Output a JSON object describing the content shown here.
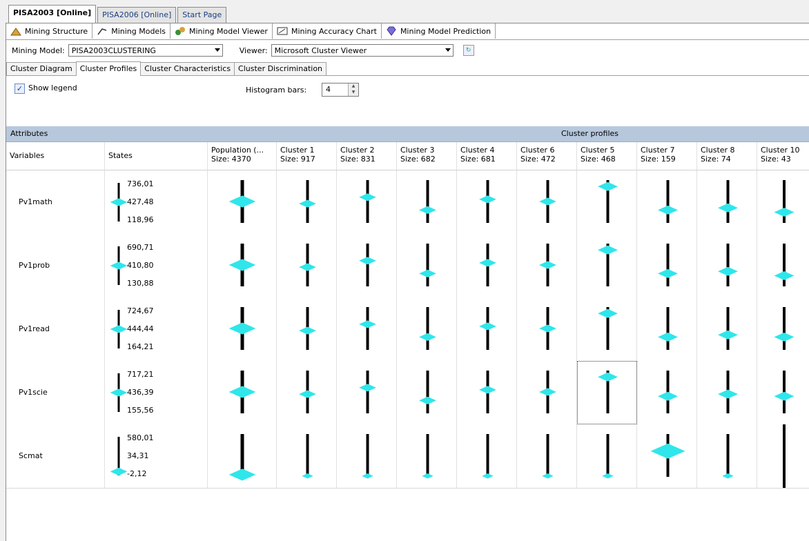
{
  "doc_tabs": [
    "PISA2003 [Online]",
    "PISA2006 [Online]",
    "Start Page"
  ],
  "designer_tabs": [
    {
      "label": "Mining Structure",
      "icon": "mining-structure-icon"
    },
    {
      "label": "Mining Models",
      "icon": "mining-models-icon"
    },
    {
      "label": "Mining Model Viewer",
      "icon": "mining-viewer-icon"
    },
    {
      "label": "Mining Accuracy Chart",
      "icon": "accuracy-chart-icon"
    },
    {
      "label": "Mining Model Prediction",
      "icon": "prediction-gem-icon"
    }
  ],
  "toolbar": {
    "model_label": "Mining Model:",
    "model_value": "PISA2003CLUSTERING",
    "viewer_label": "Viewer:",
    "viewer_value": "Microsoft Cluster Viewer"
  },
  "view_tabs": [
    "Cluster Diagram",
    "Cluster Profiles",
    "Cluster Characteristics",
    "Cluster Discrimination"
  ],
  "options": {
    "show_legend_label": "Show legend",
    "show_legend_checked": true,
    "histogram_label": "Histogram bars:",
    "histogram_value": "4"
  },
  "grid": {
    "band_attributes": "Attributes",
    "band_profiles": "Cluster profiles",
    "col_variables": "Variables",
    "col_states": "States",
    "columns": [
      {
        "name": "Population (...",
        "size": "Size: 4370"
      },
      {
        "name": "Cluster 1",
        "size": "Size: 917"
      },
      {
        "name": "Cluster 2",
        "size": "Size: 831"
      },
      {
        "name": "Cluster 3",
        "size": "Size: 682"
      },
      {
        "name": "Cluster 4",
        "size": "Size: 681"
      },
      {
        "name": "Cluster 6",
        "size": "Size: 472"
      },
      {
        "name": "Cluster 5",
        "size": "Size: 468"
      },
      {
        "name": "Cluster 7",
        "size": "Size: 159"
      },
      {
        "name": "Cluster 8",
        "size": "Size: 74"
      },
      {
        "name": "Cluster 10",
        "size": "Size: 43"
      }
    ],
    "rows": [
      {
        "variable": "Pv1math",
        "states": [
          "736,01",
          "427,48",
          "118,96"
        ],
        "profiles": [
          [
            0.5,
            0.22
          ],
          [
            0.45,
            0.12
          ],
          [
            0.6,
            0.12
          ],
          [
            0.3,
            0.12
          ],
          [
            0.55,
            0.12
          ],
          [
            0.5,
            0.12
          ],
          [
            0.85,
            0.15
          ],
          [
            0.3,
            0.15
          ],
          [
            0.35,
            0.15
          ],
          [
            0.25,
            0.15
          ]
        ]
      },
      {
        "variable": "Pv1prob",
        "states": [
          "690,71",
          "410,80",
          "130,88"
        ],
        "profiles": [
          [
            0.5,
            0.22
          ],
          [
            0.45,
            0.12
          ],
          [
            0.6,
            0.12
          ],
          [
            0.3,
            0.12
          ],
          [
            0.55,
            0.12
          ],
          [
            0.5,
            0.12
          ],
          [
            0.85,
            0.15
          ],
          [
            0.3,
            0.15
          ],
          [
            0.35,
            0.15
          ],
          [
            0.25,
            0.15
          ]
        ]
      },
      {
        "variable": "Pv1read",
        "states": [
          "724,67",
          "444,44",
          "164,21"
        ],
        "profiles": [
          [
            0.5,
            0.22
          ],
          [
            0.45,
            0.12
          ],
          [
            0.6,
            0.12
          ],
          [
            0.3,
            0.12
          ],
          [
            0.55,
            0.12
          ],
          [
            0.5,
            0.12
          ],
          [
            0.85,
            0.15
          ],
          [
            0.3,
            0.15
          ],
          [
            0.35,
            0.15
          ],
          [
            0.3,
            0.15
          ]
        ]
      },
      {
        "variable": "Pv1scie",
        "states": [
          "717,21",
          "436,39",
          "155,56"
        ],
        "profiles": [
          [
            0.5,
            0.22
          ],
          [
            0.45,
            0.12
          ],
          [
            0.6,
            0.12
          ],
          [
            0.3,
            0.12
          ],
          [
            0.55,
            0.12
          ],
          [
            0.5,
            0.12
          ],
          [
            0.85,
            0.15
          ],
          [
            0.4,
            0.15
          ],
          [
            0.45,
            0.15
          ],
          [
            0.4,
            0.15
          ]
        ]
      },
      {
        "variable": "Scmat",
        "states": [
          "580,01",
          "34,31",
          "-2,12"
        ],
        "profiles": [
          [
            0.05,
            0.22
          ],
          [
            0.02,
            0.06
          ],
          [
            0.02,
            0.06
          ],
          [
            0.02,
            0.06
          ],
          [
            0.02,
            0.06
          ],
          [
            0.02,
            0.06
          ],
          [
            0.02,
            0.06
          ],
          [
            0.6,
            0.3
          ],
          [
            0.02,
            0.06
          ],
          [
            0.0,
            0.0
          ]
        ]
      }
    ]
  },
  "colors": {
    "accent": "#2fe6ea",
    "bar": "#000000",
    "band": "#b7c8dd"
  }
}
